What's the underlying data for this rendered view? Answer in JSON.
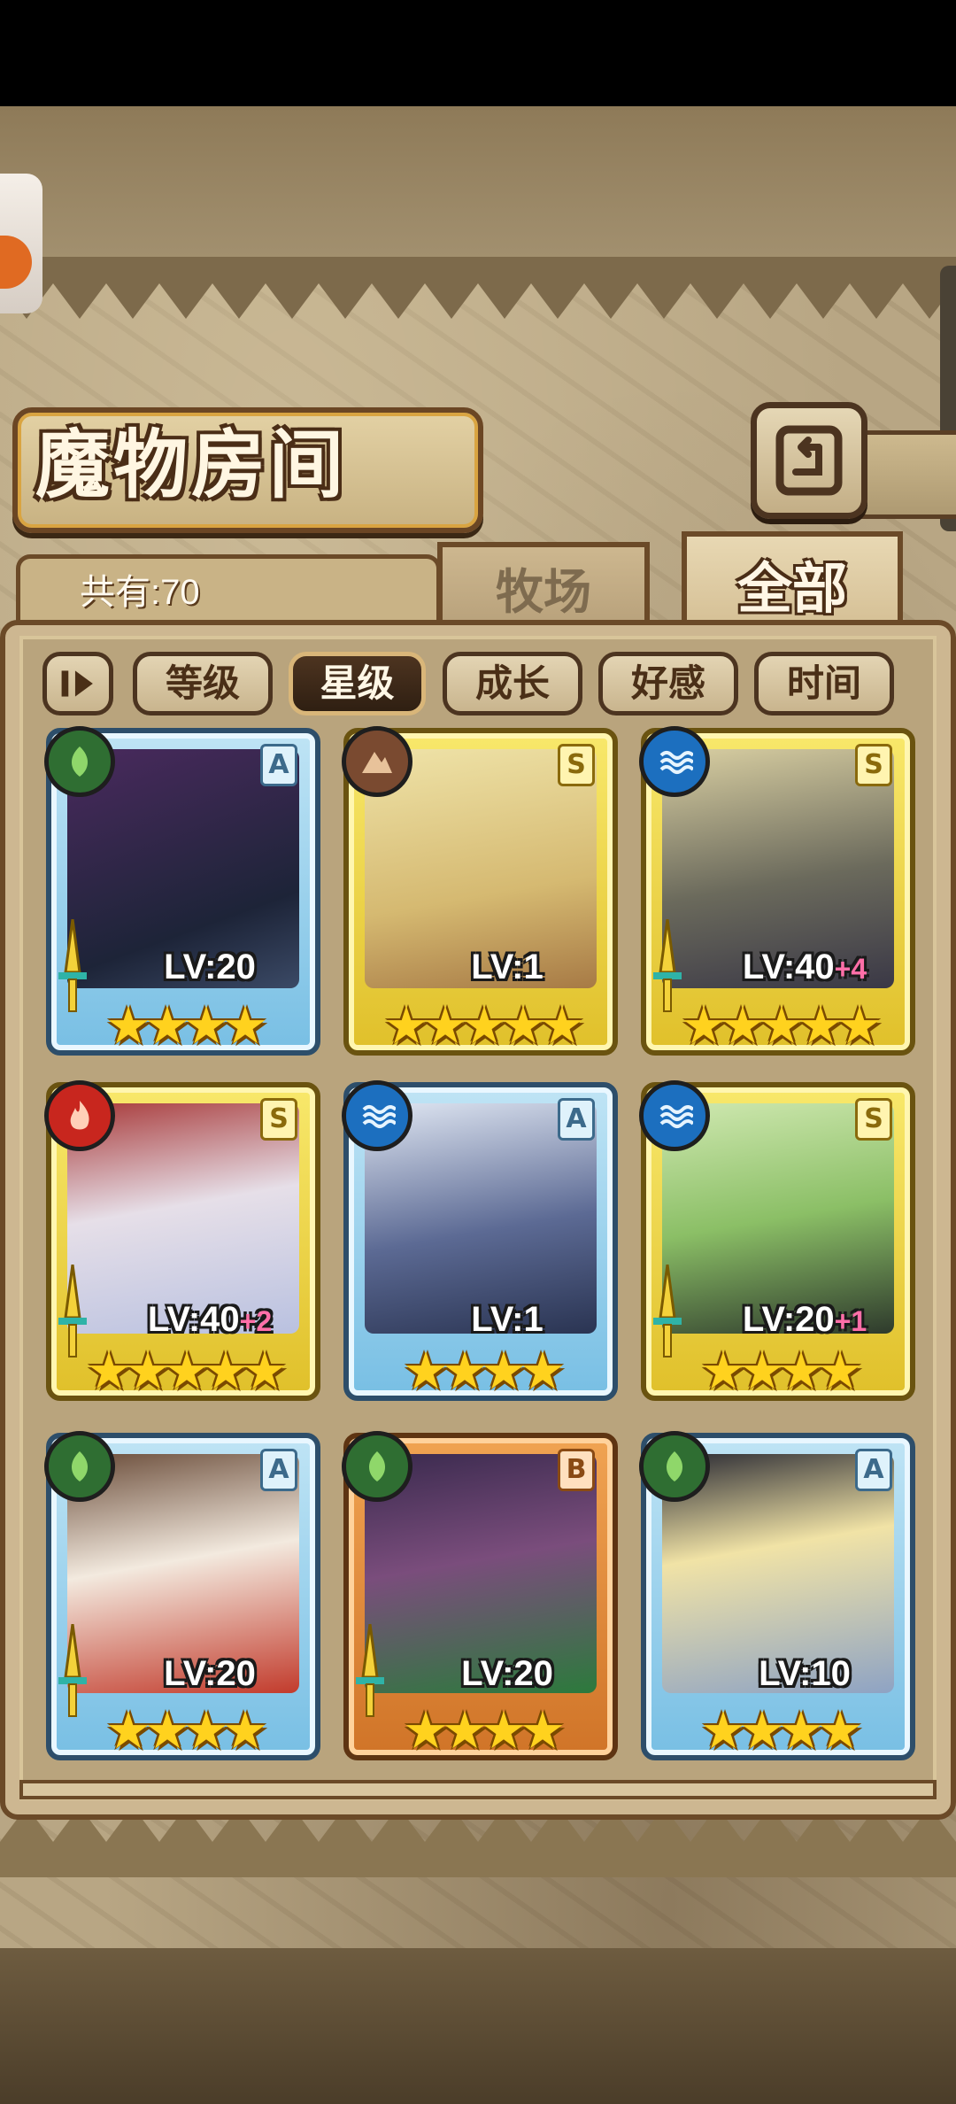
{
  "screen": {
    "title": "魔物房间",
    "count_label": "共有:70"
  },
  "tabs": [
    {
      "label": "牧场",
      "active": false
    },
    {
      "label": "全部",
      "active": true
    }
  ],
  "sort": {
    "toggle_icon": "sort-order-icon",
    "options": [
      {
        "label": "等级",
        "active": false
      },
      {
        "label": "星级",
        "active": true
      },
      {
        "label": "成长",
        "active": false
      },
      {
        "label": "好感",
        "active": false
      },
      {
        "label": "时间",
        "active": false
      }
    ]
  },
  "monsters": [
    {
      "rank": "A",
      "element": "grass",
      "level": "LV:20",
      "bonus": "",
      "stars": 4,
      "frame": "blue"
    },
    {
      "rank": "S",
      "element": "earth",
      "level": "LV:1",
      "bonus": "",
      "stars": 5,
      "frame": "gold"
    },
    {
      "rank": "S",
      "element": "water",
      "level": "LV:40",
      "bonus": "+4",
      "stars": 5,
      "frame": "gold"
    },
    {
      "rank": "S",
      "element": "fire",
      "level": "LV:40",
      "bonus": "+2",
      "stars": 5,
      "frame": "gold"
    },
    {
      "rank": "A",
      "element": "water",
      "level": "LV:1",
      "bonus": "",
      "stars": 4,
      "frame": "blue"
    },
    {
      "rank": "S",
      "element": "water",
      "level": "LV:20",
      "bonus": "+1",
      "stars": 4,
      "frame": "gold"
    },
    {
      "rank": "A",
      "element": "grass",
      "level": "LV:20",
      "bonus": "",
      "stars": 4,
      "frame": "blue"
    },
    {
      "rank": "B",
      "element": "grass",
      "level": "LV:20",
      "bonus": "",
      "stars": 4,
      "frame": "bronze"
    },
    {
      "rank": "A",
      "element": "grass",
      "level": "LV:10",
      "bonus": "",
      "stars": 4,
      "frame": "blue"
    }
  ],
  "stars_text": {
    "four": "★★★★",
    "five": "★★★★★"
  },
  "colors": {
    "parchment": "#b8a684",
    "frame_dark": "#6b4a28",
    "star": "#ffd21e",
    "bonus": "#ff6fa8"
  }
}
